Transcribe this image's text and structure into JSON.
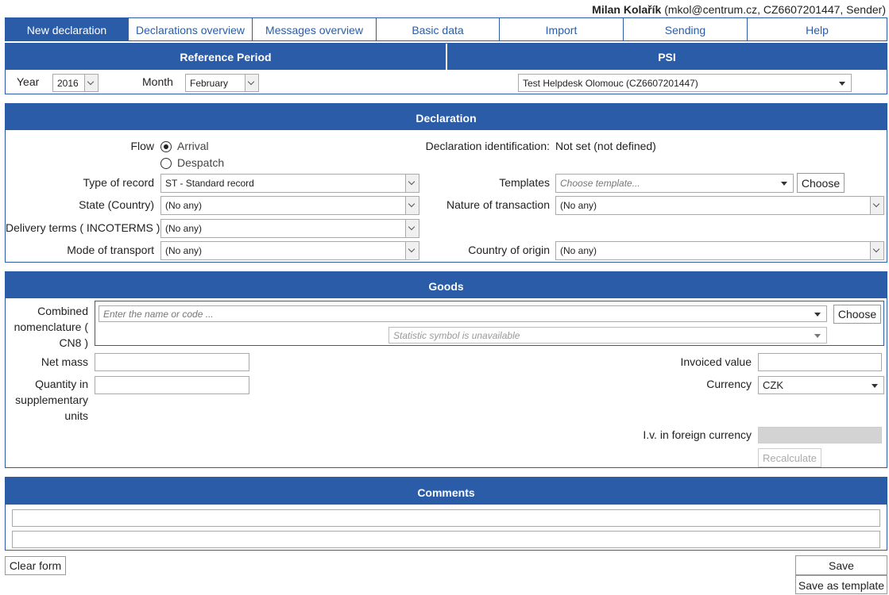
{
  "user": {
    "name": "Milan Kolařík",
    "details": "(mkol@centrum.cz, CZ6607201447, Sender)"
  },
  "nav": {
    "tabs": [
      {
        "label": "New declaration",
        "active": true
      },
      {
        "label": "Declarations overview"
      },
      {
        "label": "Messages overview"
      },
      {
        "label": "Basic data"
      },
      {
        "label": "Import"
      },
      {
        "label": "Sending"
      },
      {
        "label": "Help"
      }
    ]
  },
  "reference": {
    "header": "Reference Period",
    "year_label": "Year",
    "year_value": "2016",
    "month_label": "Month",
    "month_value": "February"
  },
  "psi": {
    "header": "PSI",
    "value": "Test Helpdesk Olomouc (CZ6607201447)"
  },
  "declaration": {
    "header": "Declaration",
    "flow_label": "Flow",
    "flow_options": [
      "Arrival",
      "Despatch"
    ],
    "flow_selected": "Arrival",
    "id_label": "Declaration identification:",
    "id_value": "Not set (not defined)",
    "type_label": "Type of record",
    "type_value": "ST - Standard record",
    "templates_label": "Templates",
    "templates_placeholder": "Choose template...",
    "choose_label": "Choose",
    "state_label": "State (Country)",
    "state_value": "(No any)",
    "nature_label": "Nature of transaction",
    "nature_value": "(No any)",
    "delivery_label": "Delivery terms ( INCOTERMS )",
    "delivery_value": "(No any)",
    "transport_label": "Mode of transport",
    "transport_value": "(No any)",
    "origin_label": "Country of origin",
    "origin_value": "(No any)"
  },
  "goods": {
    "header": "Goods",
    "cn_label_1": "Combined",
    "cn_label_2": "nomenclature (",
    "cn_label_3": "CN8 )",
    "cn_placeholder": "Enter the name or code ...",
    "stat_placeholder": "Statistic symbol is unavailable",
    "choose_label": "Choose",
    "net_mass_label": "Net mass",
    "qty_label_1": "Quantity in",
    "qty_label_2": "supplementary",
    "qty_label_3": "units",
    "invoiced_label": "Invoiced value",
    "currency_label": "Currency",
    "currency_value": "CZK",
    "foreign_label": "I.v. in foreign currency",
    "recalc_label": "Recalculate"
  },
  "comments": {
    "header": "Comments"
  },
  "actions": {
    "clear": "Clear form",
    "save": "Save",
    "save_template": "Save as template"
  },
  "colors": {
    "accent": "#2a5ca8"
  }
}
